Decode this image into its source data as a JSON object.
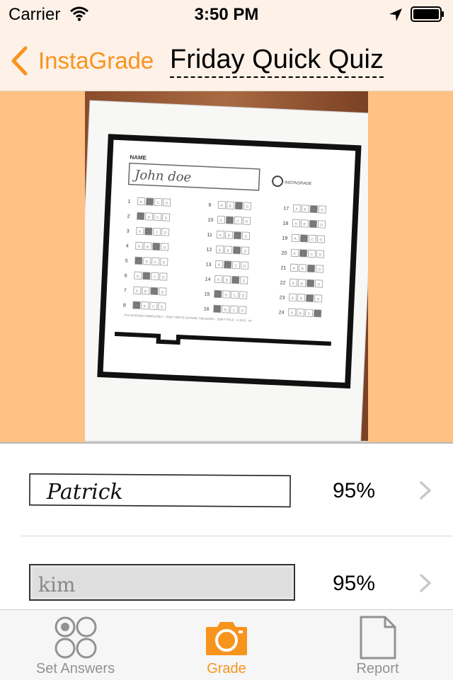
{
  "status_bar": {
    "carrier": "Carrier",
    "time": "3:50 PM"
  },
  "nav": {
    "back_label": "InstaGrade",
    "title": "Friday Quick Quiz"
  },
  "sheet": {
    "name_label": "NAME",
    "student_name": "John doe",
    "logo_text": "INSTAGRADE",
    "footer_text": "FILL IN BOXES COMPLETELY · DON'T WRITE OUTSIDE THE BOXES · DON'T FOLD · © 2013 · V4",
    "question_numbers": [
      "1",
      "2",
      "3",
      "4",
      "5",
      "6",
      "7",
      "8",
      "9",
      "10",
      "11",
      "12",
      "13",
      "14",
      "15",
      "16",
      "17",
      "18",
      "19",
      "20",
      "21",
      "22",
      "23",
      "24"
    ],
    "choices": [
      "A",
      "B",
      "C",
      "D"
    ]
  },
  "results": [
    {
      "name": "Patrick",
      "score": "95%"
    },
    {
      "name": "kim",
      "score": "95%"
    }
  ],
  "tabs": [
    {
      "label": "Set Answers",
      "icon": "set-answers-icon",
      "active": false
    },
    {
      "label": "Grade",
      "icon": "camera-icon",
      "active": true
    },
    {
      "label": "Report",
      "icon": "report-icon",
      "active": false
    }
  ],
  "colors": {
    "accent": "#f7941d",
    "photo_background": "#ffc284",
    "nav_background": "#fdf1e8",
    "tab_inactive": "#929292"
  }
}
